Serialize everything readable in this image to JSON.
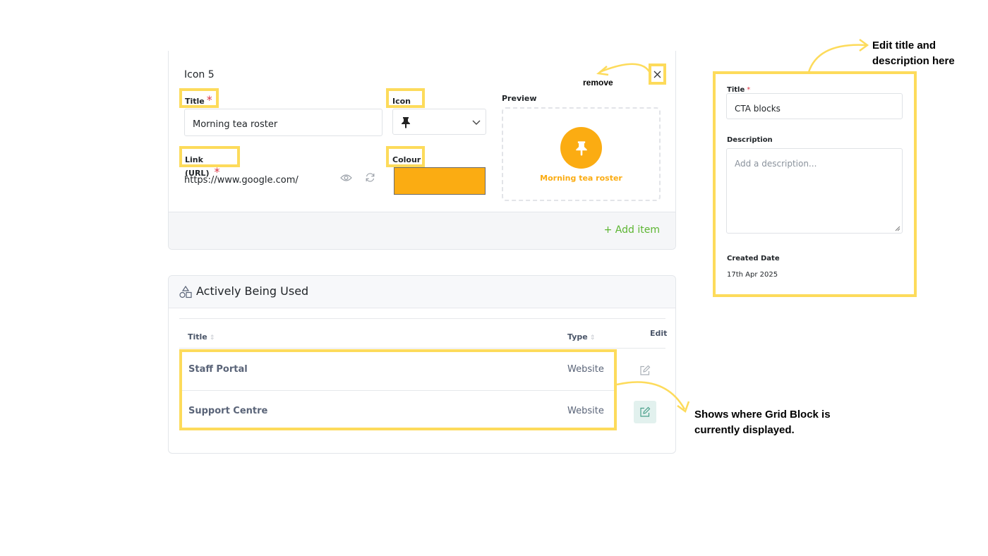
{
  "editor": {
    "item_heading": "Icon 5",
    "title_label": "Title",
    "required_mark": "*",
    "title_value": "Morning tea roster",
    "icon_label": "Icon",
    "icon_name": "pushpin-icon",
    "preview_label": "Preview",
    "preview_title": "Morning tea roster",
    "link_label": "Link (URL)",
    "link_value": "https://www.google.com/",
    "colour_label": "Colour",
    "colour_value": "#fbac12",
    "add_item_label": "+ Add item"
  },
  "actively_used": {
    "heading": "Actively Being Used",
    "columns": {
      "title": "Title",
      "type": "Type",
      "edit": "Edit"
    },
    "rows": [
      {
        "title": "Staff Portal",
        "type": "Website"
      },
      {
        "title": "Support Centre",
        "type": "Website"
      }
    ]
  },
  "details_panel": {
    "title_label": "Title",
    "required_mark": "*",
    "title_value": "CTA blocks",
    "description_label": "Description",
    "description_placeholder": "Add a description...",
    "created_label": "Created Date",
    "created_value": "17th Apr 2025"
  },
  "annotations": {
    "remove": "remove",
    "edit_title_line1": "Edit title and",
    "edit_title_line2": "description here",
    "shows_where_line1": "Shows where Grid Block is",
    "shows_where_line2": "currently displayed."
  },
  "colors": {
    "highlight": "#fddb5b",
    "accent_orange": "#fbac12",
    "add_green": "#5cb531",
    "required_red": "#dc3545"
  }
}
